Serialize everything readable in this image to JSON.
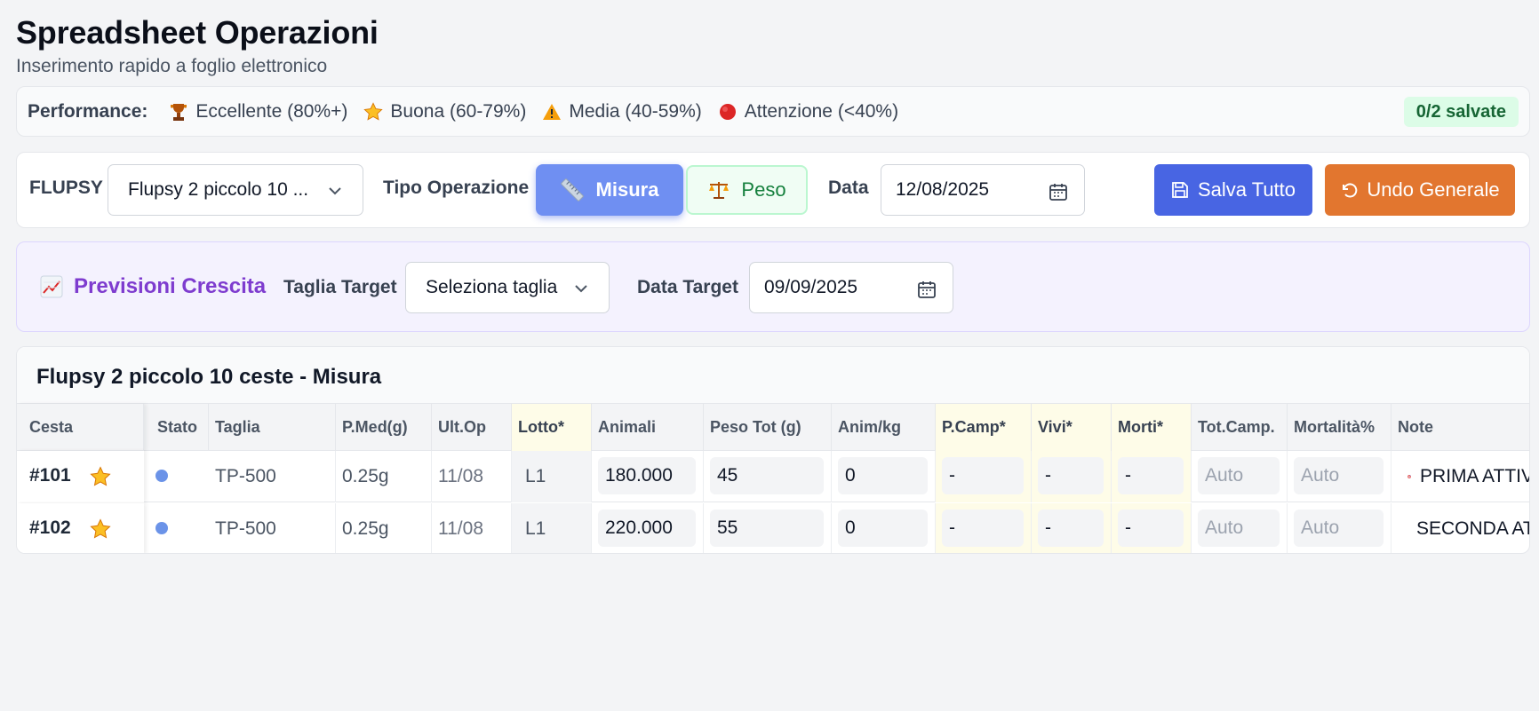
{
  "header": {
    "title": "Spreadsheet Operazioni",
    "subtitle": "Inserimento rapido a foglio elettronico"
  },
  "performance": {
    "label": "Performance:",
    "items": [
      {
        "icon": "trophy-icon",
        "text": "Eccellente (80%+)"
      },
      {
        "icon": "star-icon",
        "text": "Buona (60-79%)"
      },
      {
        "icon": "warning-icon",
        "text": "Media (40-59%)"
      },
      {
        "icon": "red-circle-icon",
        "text": "Attenzione (<40%)"
      }
    ],
    "saved_badge": "0/2 salvate"
  },
  "toolbar": {
    "flupsy_label": "FLUPSY",
    "flupsy_value": "Flupsy 2 piccolo 10 ...",
    "tipo_label": "Tipo Operazione",
    "misura_label": "Misura",
    "peso_label": "Peso",
    "data_label": "Data",
    "data_value": "12/08/2025",
    "save_label": "Salva Tutto",
    "undo_label": "Undo Generale"
  },
  "previsioni": {
    "title": "Previsioni Crescita",
    "taglia_label": "Taglia Target",
    "taglia_value": "Seleziona taglia",
    "data_label": "Data Target",
    "data_value": "09/09/2025"
  },
  "table": {
    "title": "Flupsy 2 piccolo 10 ceste - Misura",
    "columns": [
      "Cesta",
      "Stato",
      "Taglia",
      "P.Med(g)",
      "Ult.Op",
      "Lotto*",
      "Animali",
      "Peso Tot (g)",
      "Anim/kg",
      "P.Camp*",
      "Vivi*",
      "Morti*",
      "Tot.Camp.",
      "Mortalità%",
      "Note"
    ],
    "rows": [
      {
        "cesta": "#101",
        "taglia": "TP-500",
        "pmed": "0.25g",
        "ultop": "11/08",
        "lotto": "L1",
        "animali": "180.000",
        "peso": "45",
        "animkg": "0",
        "pcamp": "-",
        "vivi": "-",
        "morti": "-",
        "totcamp": "Auto",
        "mortalita": "Auto",
        "note": "PRIMA ATTIV",
        "note_icon": "target-icon"
      },
      {
        "cesta": "#102",
        "taglia": "TP-500",
        "pmed": "0.25g",
        "ultop": "11/08",
        "lotto": "L1",
        "animali": "220.000",
        "peso": "55",
        "animkg": "0",
        "pcamp": "-",
        "vivi": "-",
        "morti": "-",
        "totcamp": "Auto",
        "mortalita": "Auto",
        "note": "SECONDA AT",
        "note_icon": "repeat-icon"
      }
    ]
  }
}
